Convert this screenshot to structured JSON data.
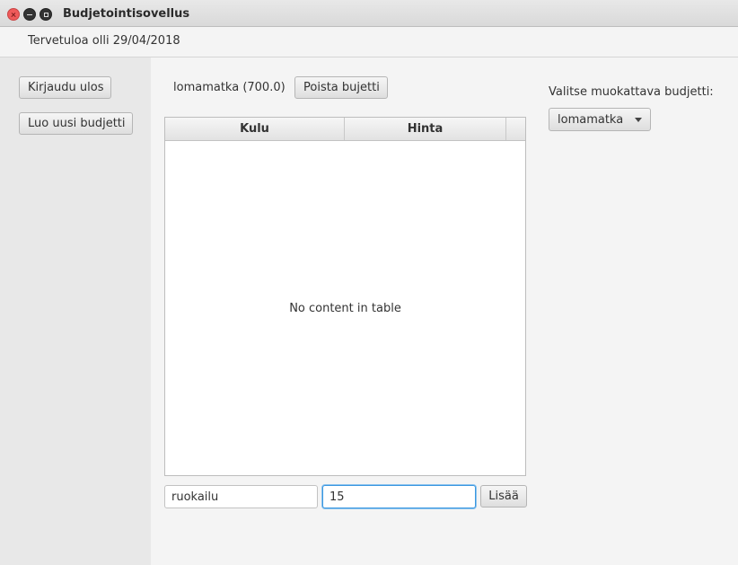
{
  "window": {
    "title": "Budjetointisovellus"
  },
  "header": {
    "welcome": "Tervetuloa olli 29/04/2018"
  },
  "sidebar": {
    "logout_label": "Kirjaudu ulos",
    "new_budget_label": "Luo uusi budjetti"
  },
  "budget": {
    "current_label": "lomamatka (700.0)",
    "delete_label": "Poista bujetti"
  },
  "table": {
    "columns": [
      "Kulu",
      "Hinta"
    ],
    "rows": [],
    "placeholder": "No content in table"
  },
  "form": {
    "expense_value": "ruokailu",
    "price_value": "15",
    "add_label": "Lisää"
  },
  "selector": {
    "label": "Valitse muokattava budjetti:",
    "selected": "lomamatka"
  },
  "colors": {
    "focus": "#3a97e0",
    "close": "#ef5a5a"
  }
}
